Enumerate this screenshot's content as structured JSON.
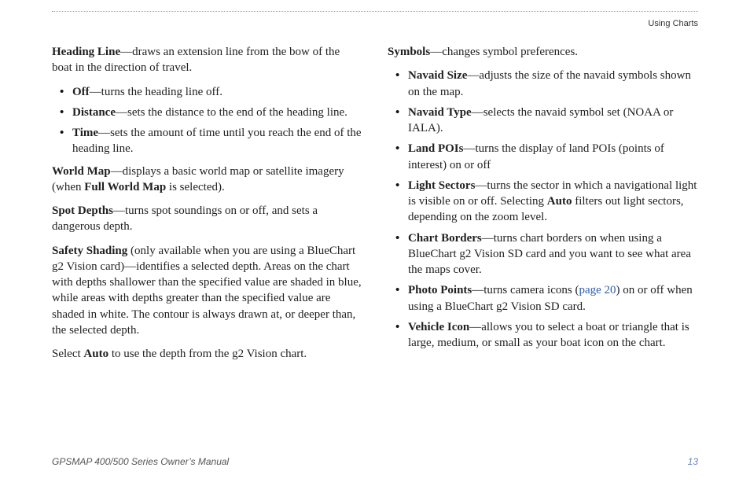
{
  "header": {
    "section": "Using Charts"
  },
  "left": {
    "headingLine": {
      "term": "Heading Line",
      "dash": "—",
      "desc": "draws an extension line from the bow of the boat in the direction of travel."
    },
    "headingOptions": [
      {
        "term": "Off",
        "dash": "—",
        "desc": "turns the heading line off."
      },
      {
        "term": "Distance",
        "dash": "—",
        "desc": "sets the distance to the end of the heading line."
      },
      {
        "term": "Time",
        "dash": "—",
        "desc": "sets the amount of time until you reach the end of the heading line."
      }
    ],
    "worldMap": {
      "term": "World Map",
      "dash": "—",
      "desc_a": "displays a basic world map or satellite imagery (when ",
      "bold_inline": "Full World Map",
      "desc_b": " is selected)."
    },
    "spotDepths": {
      "term": "Spot Depths",
      "dash": "—",
      "desc": "turns spot soundings on or off, and sets a dangerous depth."
    },
    "safetyShading": {
      "term": "Safety Shading",
      "desc": " (only available when you are using a BlueChart g2 Vision card)—identifies a selected depth. Areas on the chart with depths shallower than the specified value are shaded in blue, while areas with depths greater than the specified value are shaded in white. The contour is always drawn at, or deeper than, the selected depth."
    },
    "autoLine": {
      "pre": "Select ",
      "bold": "Auto",
      "post": " to use the depth from the g2 Vision chart."
    }
  },
  "right": {
    "symbols": {
      "term": "Symbols",
      "dash": "—",
      "desc": "changes symbol preferences."
    },
    "items": [
      {
        "term": "Navaid Size",
        "dash": "—",
        "desc": "adjusts the size of the navaid symbols shown on the map."
      },
      {
        "term": "Navaid Type",
        "dash": "—",
        "desc": "selects the navaid symbol set (NOAA or IALA)."
      },
      {
        "term": "Land POIs",
        "dash": "—",
        "desc": "turns the display of land POIs (points of interest) on or off"
      },
      {
        "term": "Light Sectors",
        "dash": "—",
        "desc_a": "turns the sector in which a navigational light is visible on or off. Selecting ",
        "bold_inline": "Auto",
        "desc_b": " filters out light sectors, depending on the zoom level."
      },
      {
        "term": "Chart Borders",
        "dash": "—",
        "desc": "turns chart borders on when using a BlueChart g2 Vision SD card and you want to see what area the maps cover."
      },
      {
        "term": "Photo Points",
        "dash": "—",
        "desc_a": "turns camera icons (",
        "link_text": "page 20",
        "desc_b": ") on or off when using a BlueChart g2 Vision SD card."
      },
      {
        "term": "Vehicle Icon",
        "dash": "—",
        "desc": "allows you to select a boat or triangle that is large, medium, or small as your boat icon on the chart."
      }
    ]
  },
  "footer": {
    "manual": "GPSMAP 400/500 Series Owner’s Manual",
    "page": "13"
  }
}
